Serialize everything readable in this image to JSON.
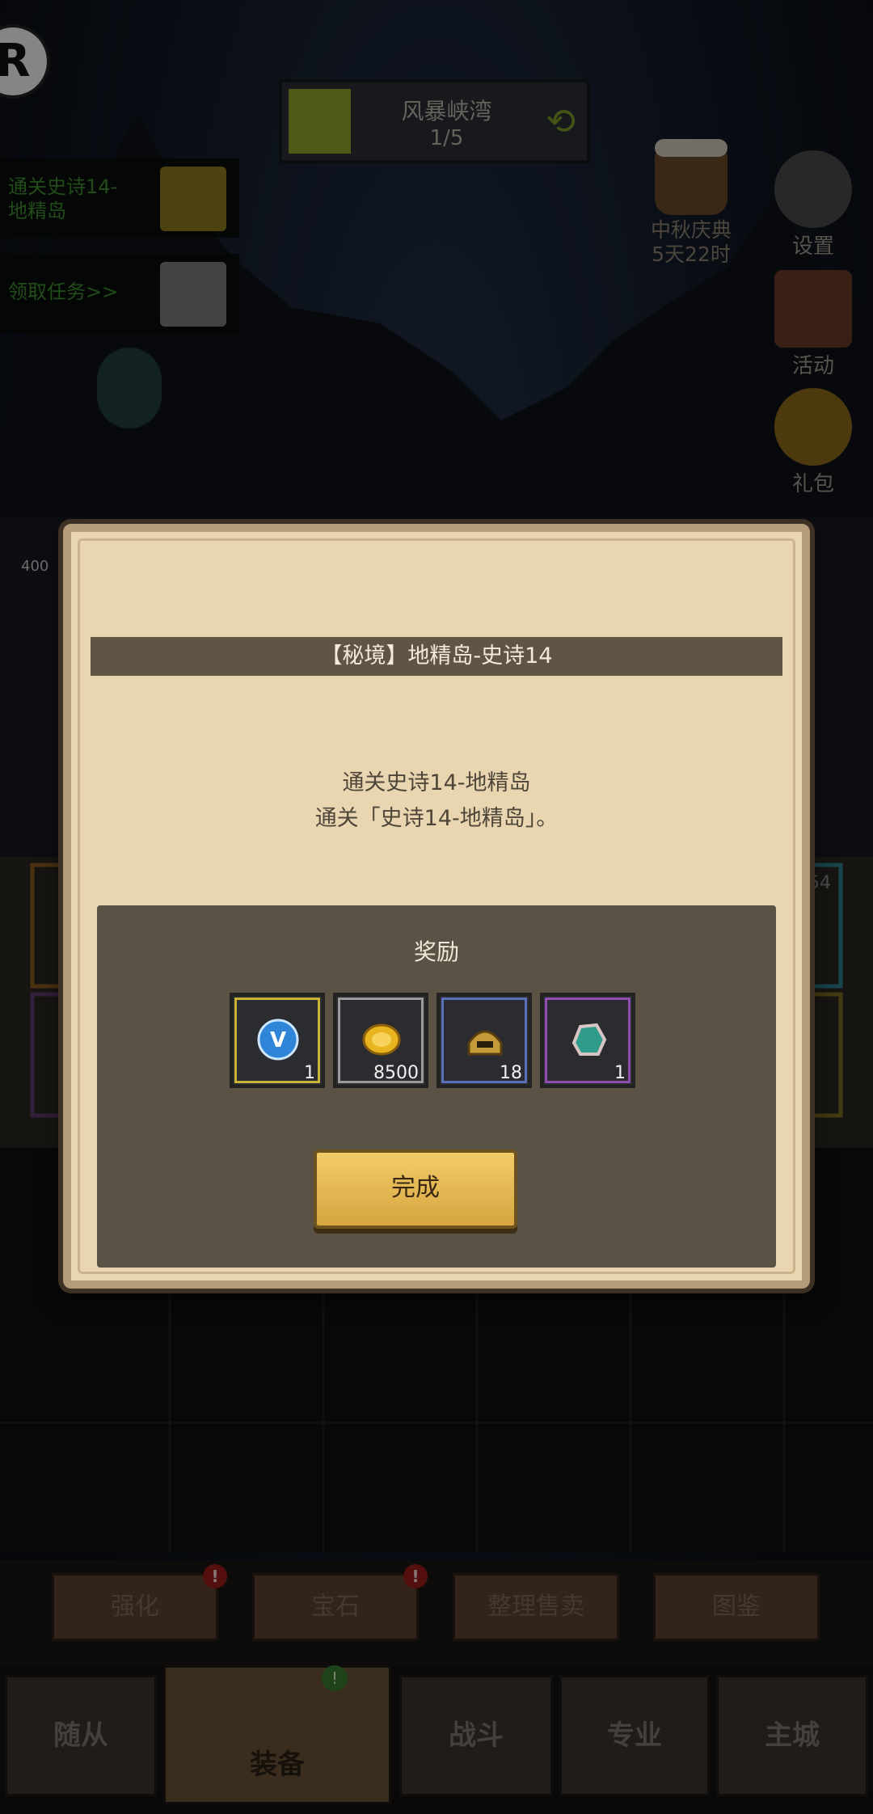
{
  "top": {
    "zone_name": "风暴峡湾",
    "zone_progress": "1/5",
    "zone_progress_value": 0.2,
    "quest1_text": "通关史诗14-\n地精岛",
    "quest2_text": "领取任务>>",
    "festival_name": "中秋庆典",
    "festival_time": "5天22时",
    "settings_label": "设置",
    "activity_label": "活动",
    "gift_label": "礼包",
    "side_value": "400",
    "right_value": "54"
  },
  "dialog": {
    "title": "【秘境】地精岛-史诗14",
    "desc_line1": "通关史诗14-地精岛",
    "desc_line2": "通关「史诗14-地精岛」。",
    "reward_title": "奖励",
    "rewards": [
      {
        "icon": "v-token-icon",
        "qty": "1",
        "frame": "#c9b23a"
      },
      {
        "icon": "gold-coin-icon",
        "qty": "8500",
        "frame": "#9a9a9a"
      },
      {
        "icon": "helmet-icon",
        "qty": "18",
        "frame": "#5a6fb8"
      },
      {
        "icon": "ore-gem-icon",
        "qty": "1",
        "frame": "#8e4fb0"
      }
    ],
    "done_label": "完成"
  },
  "sub_buttons": [
    "强化",
    "宝石",
    "整理售卖",
    "图鉴"
  ],
  "nav": [
    "随从",
    "装备",
    "战斗",
    "专业",
    "主城"
  ],
  "nav_badge": "!",
  "alert_badge": "!"
}
